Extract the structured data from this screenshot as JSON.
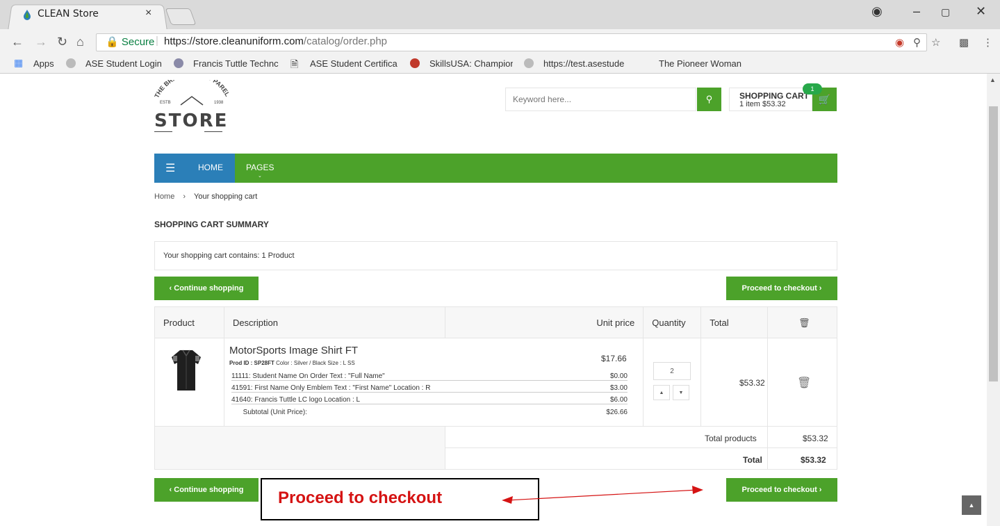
{
  "browser": {
    "tab_title": "CLEAN Store",
    "tab_close": "×",
    "secure_label": "Secure",
    "url_domain": "https://store.cleanuniform.com",
    "url_path": "/catalog/order.php",
    "bookmarks": [
      "Apps",
      "ASE Student Login",
      "Francis Tuttle Technc",
      "ASE Student Certifica",
      "SkillsUSA: Champion",
      "https://test.asestude",
      "The Pioneer Woman"
    ]
  },
  "header": {
    "logo_arc": "THE BRANDING & APPAREL",
    "logo_store": "STORE",
    "logo_estb": "ESTB",
    "logo_year": "1938",
    "search_placeholder": "Keyword here...",
    "cart_title": "SHOPPING CART",
    "cart_summary": "1 item $53.32",
    "cart_badge": "1"
  },
  "nav": {
    "home": "HOME",
    "pages": "PAGES"
  },
  "breadcrumb": {
    "home": "Home",
    "separator": "›",
    "current": "Your shopping cart"
  },
  "page": {
    "title": "SHOPPING CART SUMMARY",
    "contains": "Your shopping cart contains: 1 Product",
    "continue_label": "‹   Continue shopping",
    "checkout_label": "Proceed to checkout   ›"
  },
  "table": {
    "headers": [
      "Product",
      "Description",
      "Unit price",
      "Quantity",
      "Total"
    ],
    "item": {
      "name": "MotorSports Image Shirt FT",
      "prod_id_label": "Prod ID : SP28FT",
      "meta": " Color : Silver / Black Size : L SS",
      "unit_price": "$17.66",
      "quantity": "2",
      "total": "$53.32",
      "options": [
        {
          "text": "11111: Student Name On Order    Text : \"Full Name\"",
          "price": "$0.00"
        },
        {
          "text": "41591: First Name Only Emblem    Text : \"First Name\"     Location : R",
          "price": "$3.00"
        },
        {
          "text": "41640: Francis Tuttle LC logo    Location : L",
          "price": "$6.00"
        },
        {
          "text": "      Subtotal (Unit Price):",
          "price": "$26.66"
        }
      ]
    },
    "total_products_label": "Total products",
    "total_products_value": "$53.32",
    "total_label": "Total",
    "total_value": "$53.32"
  },
  "annotation": {
    "text": "Proceed to checkout",
    "color": "#d51313"
  },
  "colors": {
    "green": "#4ca22a",
    "blue": "#2b7fb8"
  }
}
